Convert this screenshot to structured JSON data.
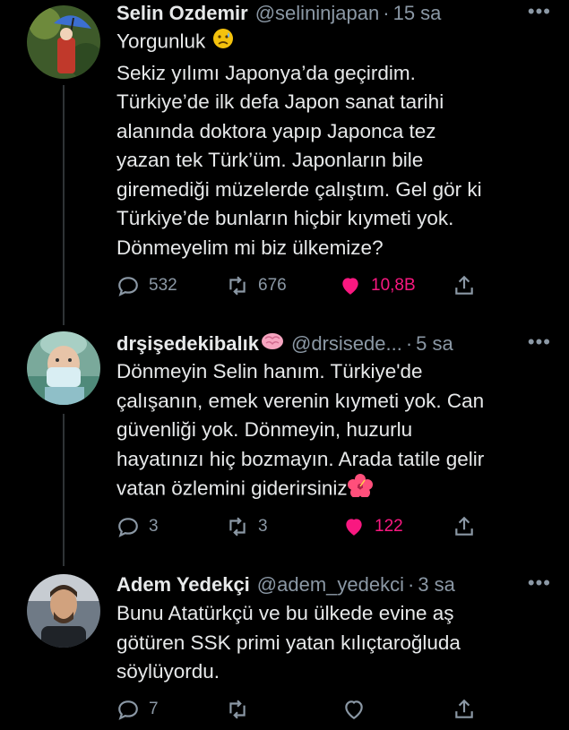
{
  "tweets": [
    {
      "name": "Selin Ozdemir",
      "handle": "@selininjapan",
      "time": "15 sa",
      "lines": [
        "Yorgunluk",
        "Sekiz yılımı Japonya’da geçirdim.",
        "Türkiye’de ilk defa Japon sanat tarihi",
        "alanında doktora yapıp Japonca tez",
        "yazan tek Türk’üm. Japonların bile",
        "giremediği müzelerde çalıştım. Gel gör ki",
        "Türkiye’de bunların hiçbir kıymeti yok.",
        "Dönmeyelim mi biz ülkemize?"
      ],
      "replies": "532",
      "retweets": "676",
      "likes": "10,8B",
      "liked": true
    },
    {
      "name": "drşişedekibalık",
      "handle": "@drsisede...",
      "time": "5 sa",
      "lines": [
        "Dönmeyin Selin hanım. Türkiye'de",
        "çalışanın, emek verenin kıymeti yok. Can",
        "güvenliği yok. Dönmeyin, huzurlu",
        "hayatınızı hiç bozmayın. Arada tatile gelir",
        "vatan özlemini giderirsiniz"
      ],
      "replies": "3",
      "retweets": "3",
      "likes": "122",
      "liked": true
    },
    {
      "name": "Adem Yedekçi",
      "handle": "@adem_yedekci",
      "time": "3 sa",
      "lines": [
        "Bunu Atatürkçü ve bu ülkede evine aş",
        "götüren SSK primi yatan kılıçtaroğluda",
        "söylüyordu."
      ],
      "replies": "7",
      "retweets": "",
      "likes": "",
      "liked": false
    }
  ],
  "colors": {
    "background": "#000000",
    "text": "#e7e9ea",
    "secondary": "#8b98a5",
    "like": "#f91880"
  }
}
